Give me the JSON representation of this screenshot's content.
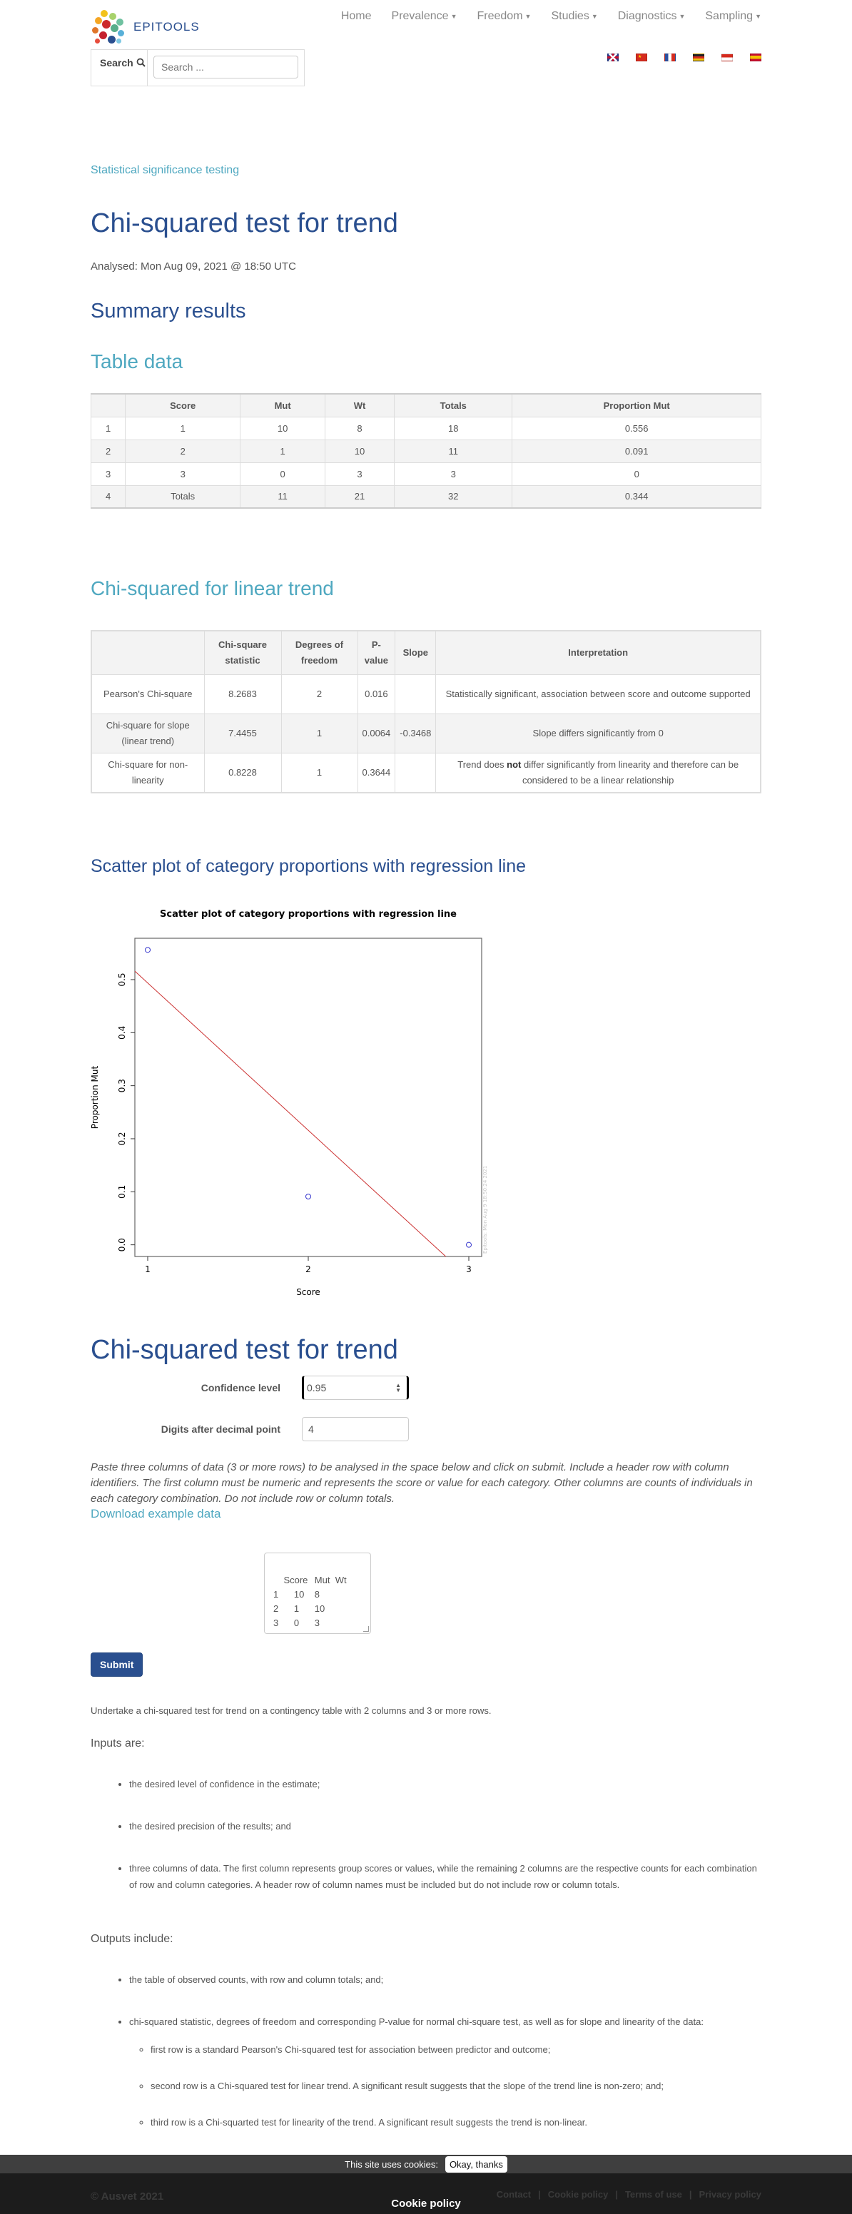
{
  "header": {
    "logo_text": "EPITOOLS",
    "nav": [
      {
        "label": "Home",
        "dropdown": false
      },
      {
        "label": "Prevalence",
        "dropdown": true
      },
      {
        "label": "Freedom",
        "dropdown": true
      },
      {
        "label": "Studies",
        "dropdown": true
      },
      {
        "label": "Diagnostics",
        "dropdown": true
      },
      {
        "label": "Sampling",
        "dropdown": true
      }
    ],
    "search": {
      "label": "Search",
      "placeholder": "Search ..."
    },
    "flags": [
      "english",
      "chinese",
      "french",
      "german",
      "indonesian",
      "spanish"
    ]
  },
  "breadcrumb": "Statistical significance testing",
  "page_title": "Chi-squared test for trend",
  "analysed": "Analysed: Mon Aug 09, 2021 @ 18:50 UTC",
  "summary_heading": "Summary results",
  "table_data": {
    "heading": "Table data",
    "columns": [
      "",
      "Score",
      "Mut",
      "Wt",
      "Totals",
      "Proportion Mut"
    ],
    "rows": [
      [
        "1",
        "1",
        "10",
        "8",
        "18",
        "0.556"
      ],
      [
        "2",
        "2",
        "1",
        "10",
        "11",
        "0.091"
      ],
      [
        "3",
        "3",
        "0",
        "3",
        "3",
        "0"
      ],
      [
        "4",
        "Totals",
        "11",
        "21",
        "32",
        "0.344"
      ]
    ]
  },
  "linear_trend": {
    "heading": "Chi-squared for linear trend",
    "columns": [
      "",
      "Chi-square statistic",
      "Degrees of freedom",
      "P-value",
      "Slope",
      "Interpretation"
    ],
    "rows": [
      {
        "name": "Pearson's Chi-square",
        "stat": "8.2683",
        "df": "2",
        "p": "0.016",
        "slope": "",
        "interp_pre": "Statistically significant, association between score and outcome supported",
        "interp_bold": "",
        "interp_post": ""
      },
      {
        "name": "Chi-square for slope (linear trend)",
        "stat": "7.4455",
        "df": "1",
        "p": "0.0064",
        "slope": "-0.3468",
        "interp_pre": "Slope differs significantly from 0",
        "interp_bold": "",
        "interp_post": ""
      },
      {
        "name": "Chi-square for non-linearity",
        "stat": "0.8228",
        "df": "1",
        "p": "0.3644",
        "slope": "",
        "interp_pre": "Trend does ",
        "interp_bold": "not",
        "interp_post": " differ significantly from linearity and therefore can be considered to be a linear relationship"
      }
    ]
  },
  "scatter_heading": "Scatter plot of category proportions with regression line",
  "chart_data": {
    "type": "scatter",
    "title": "Scatter plot of category proportions with regression line",
    "xlabel": "Score",
    "ylabel": "Proportion Mut",
    "x": [
      1,
      2,
      3
    ],
    "y": [
      0.556,
      0.091,
      0
    ],
    "xlim": [
      0.92,
      3.08
    ],
    "ylim": [
      -0.022,
      0.578
    ],
    "xticks": [
      1,
      2,
      3
    ],
    "yticks": [
      0.0,
      0.1,
      0.2,
      0.3,
      0.4,
      0.5
    ],
    "ytick_labels": [
      "0.0",
      "0.1",
      "0.2",
      "0.3",
      "0.4",
      "0.5"
    ],
    "regression_line": {
      "intercept": 0.7715,
      "slope": -0.2778,
      "color": "#cc3333"
    },
    "point_color": "#3333cc",
    "watermark": "Epitools: Mon Aug  9 18:50:24 2021"
  },
  "form": {
    "title": "Chi-squared test for trend",
    "confidence_label": "Confidence level",
    "confidence_value": "0.95",
    "digits_label": "Digits after decimal point",
    "digits_value": "4",
    "instructions": "Paste three columns of data (3 or more rows) to be analysed in the space below and click on submit. Include a header row with column identifiers. The first column must be numeric and represents the score or value for each category. Other columns are counts of individuals in each category combination. Do not include row or column totals.",
    "download_link": "Download example data",
    "textarea_value": "Score\tMut  Wt\n1\t10\t8\n2\t1\t10\n3\t0\t3",
    "submit_label": "Submit"
  },
  "description": {
    "intro": "Undertake a chi-squared test for trend on a contingency table with 2 columns and 3 or more rows.",
    "inputs_heading": "Inputs are:",
    "inputs": [
      "the desired level of confidence in the estimate;",
      "the desired precision of the results; and",
      "three columns of data. The first column represents group scores or values, while the remaining 2 columns are the respective counts for each combination of row and column categories. A header row of column names must be included but do not include row or column totals."
    ],
    "outputs_heading": "Outputs include:",
    "outputs": [
      "the table of observed counts, with row and column totals; and;",
      "chi-squared statistic, degrees of freedom and corresponding P-value for normal chi-square test, as well as for slope and linearity of the data:"
    ],
    "output_subitems": [
      "first row is a standard Pearson's Chi-squared test for association between predictor and outcome;",
      "second row is a Chi-squared test for linear trend. A significant result suggests that the slope of the trend line is non-zero; and;",
      "third row is a Chi-squarted test for linearity of the trend. A significant result suggests the trend is non-linear."
    ]
  },
  "cookie": {
    "text": "This site uses cookies:",
    "button": "Okay, thanks",
    "policy_label": "Cookie policy"
  },
  "footer": {
    "copyright": "© Ausvet 2021",
    "links": [
      "Contact",
      "Cookie policy",
      "Terms of use",
      "Privacy policy"
    ]
  }
}
